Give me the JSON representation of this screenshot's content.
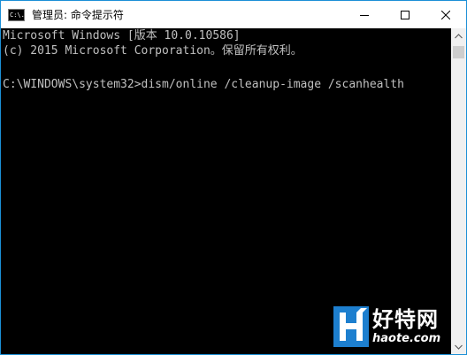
{
  "window": {
    "title": "管理员: 命令提示符",
    "icon_label": "C:\\.",
    "icon": "console-icon",
    "controls": {
      "minimize": "minimize-icon",
      "maximize": "maximize-icon",
      "close": "close-icon"
    },
    "border_color": "#1b8fd6"
  },
  "console": {
    "background": "#000000",
    "text_color": "#c0c0c0",
    "lines": [
      "Microsoft Windows [版本 10.0.10586]",
      "(c) 2015 Microsoft Corporation。保留所有权利。",
      "",
      "C:\\WINDOWS\\system32>dism/online /cleanup-image /scanhealth"
    ]
  },
  "watermark": {
    "logo_letter": "H",
    "brand_cn": "好特网",
    "url": "haote.com",
    "color": "#1d7fcf"
  }
}
